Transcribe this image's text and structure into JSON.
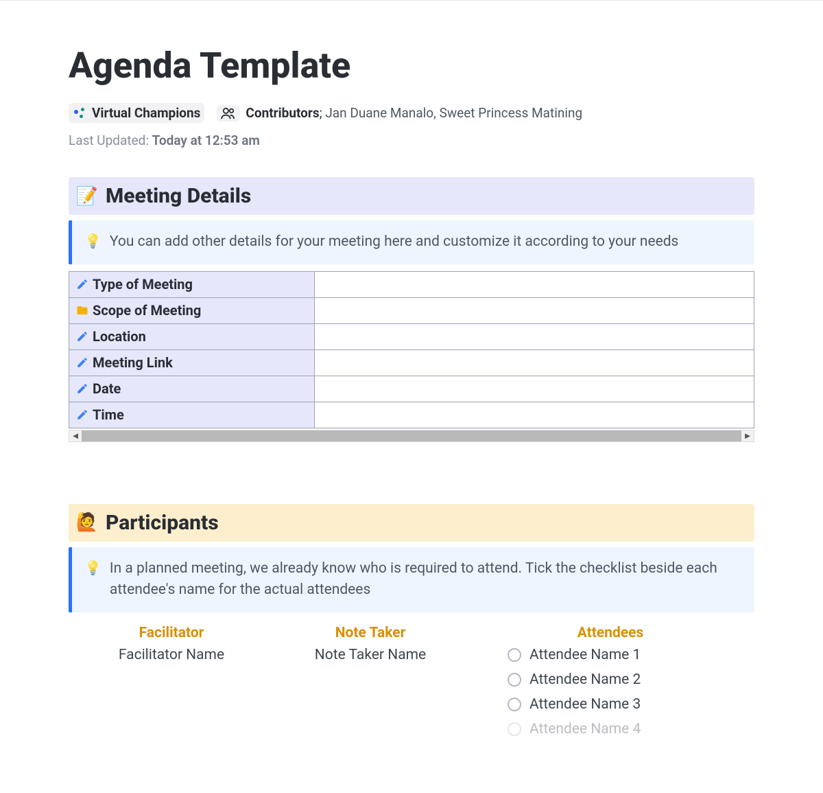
{
  "header": {
    "title": "Agenda Template",
    "team": "Virtual Champions",
    "contributors_label": "Contributors",
    "contributors_names": "Jan Duane Manalo, Sweet Princess Matining",
    "last_updated_label": "Last Updated:",
    "last_updated_value": "Today at 12:53 am"
  },
  "meeting_details": {
    "heading": "Meeting Details",
    "callout": "You can add other details for your meeting here and customize it according to your needs",
    "rows": [
      {
        "icon": "pencil",
        "label": "Type of Meeting",
        "value": ""
      },
      {
        "icon": "folder",
        "label": "Scope of Meeting",
        "value": ""
      },
      {
        "icon": "pencil",
        "label": "Location",
        "value": ""
      },
      {
        "icon": "pencil",
        "label": "Meeting Link",
        "value": ""
      },
      {
        "icon": "pencil",
        "label": "Date",
        "value": ""
      },
      {
        "icon": "pencil",
        "label": "Time",
        "value": ""
      }
    ]
  },
  "participants": {
    "heading": "Participants",
    "callout": "In a planned meeting, we already know who is required to attend. Tick the checklist beside each attendee's name for the actual attendees",
    "facilitator_label": "Facilitator",
    "facilitator_value": "Facilitator Name",
    "note_taker_label": "Note Taker",
    "note_taker_value": "Note Taker Name",
    "attendees_label": "Attendees",
    "attendees": [
      "Attendee Name 1",
      "Attendee Name 2",
      "Attendee Name 3",
      "Attendee Name 4"
    ]
  }
}
